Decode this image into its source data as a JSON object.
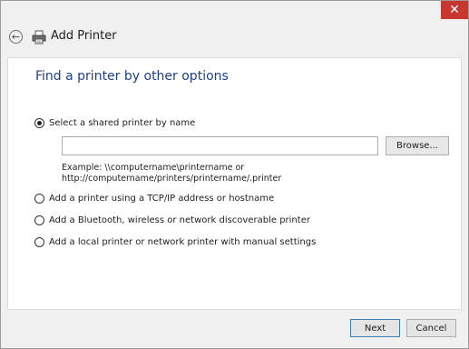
{
  "window": {
    "title": "Add Printer",
    "close_glyph": "✕"
  },
  "icons": {
    "back": "back-arrow-icon",
    "printer": "printer-icon",
    "close": "close-icon"
  },
  "page": {
    "heading": "Find a printer by other options",
    "options": [
      {
        "label": "Select a shared printer by name",
        "selected": true
      },
      {
        "label": "Add a printer using a TCP/IP address or hostname",
        "selected": false
      },
      {
        "label": "Add a Bluetooth, wireless or network discoverable printer",
        "selected": false
      },
      {
        "label": "Add a local printer or network printer with manual settings",
        "selected": false
      }
    ],
    "shared_printer_input": {
      "value": ""
    },
    "browse_label": "Browse...",
    "example_line1": "Example: \\\\computername\\printername or",
    "example_line2": "http://computername/printers/printername/.printer"
  },
  "footer": {
    "next_label": "Next",
    "cancel_label": "Cancel"
  },
  "colors": {
    "heading": "#1d3f86",
    "close_button": "#c7372f"
  }
}
